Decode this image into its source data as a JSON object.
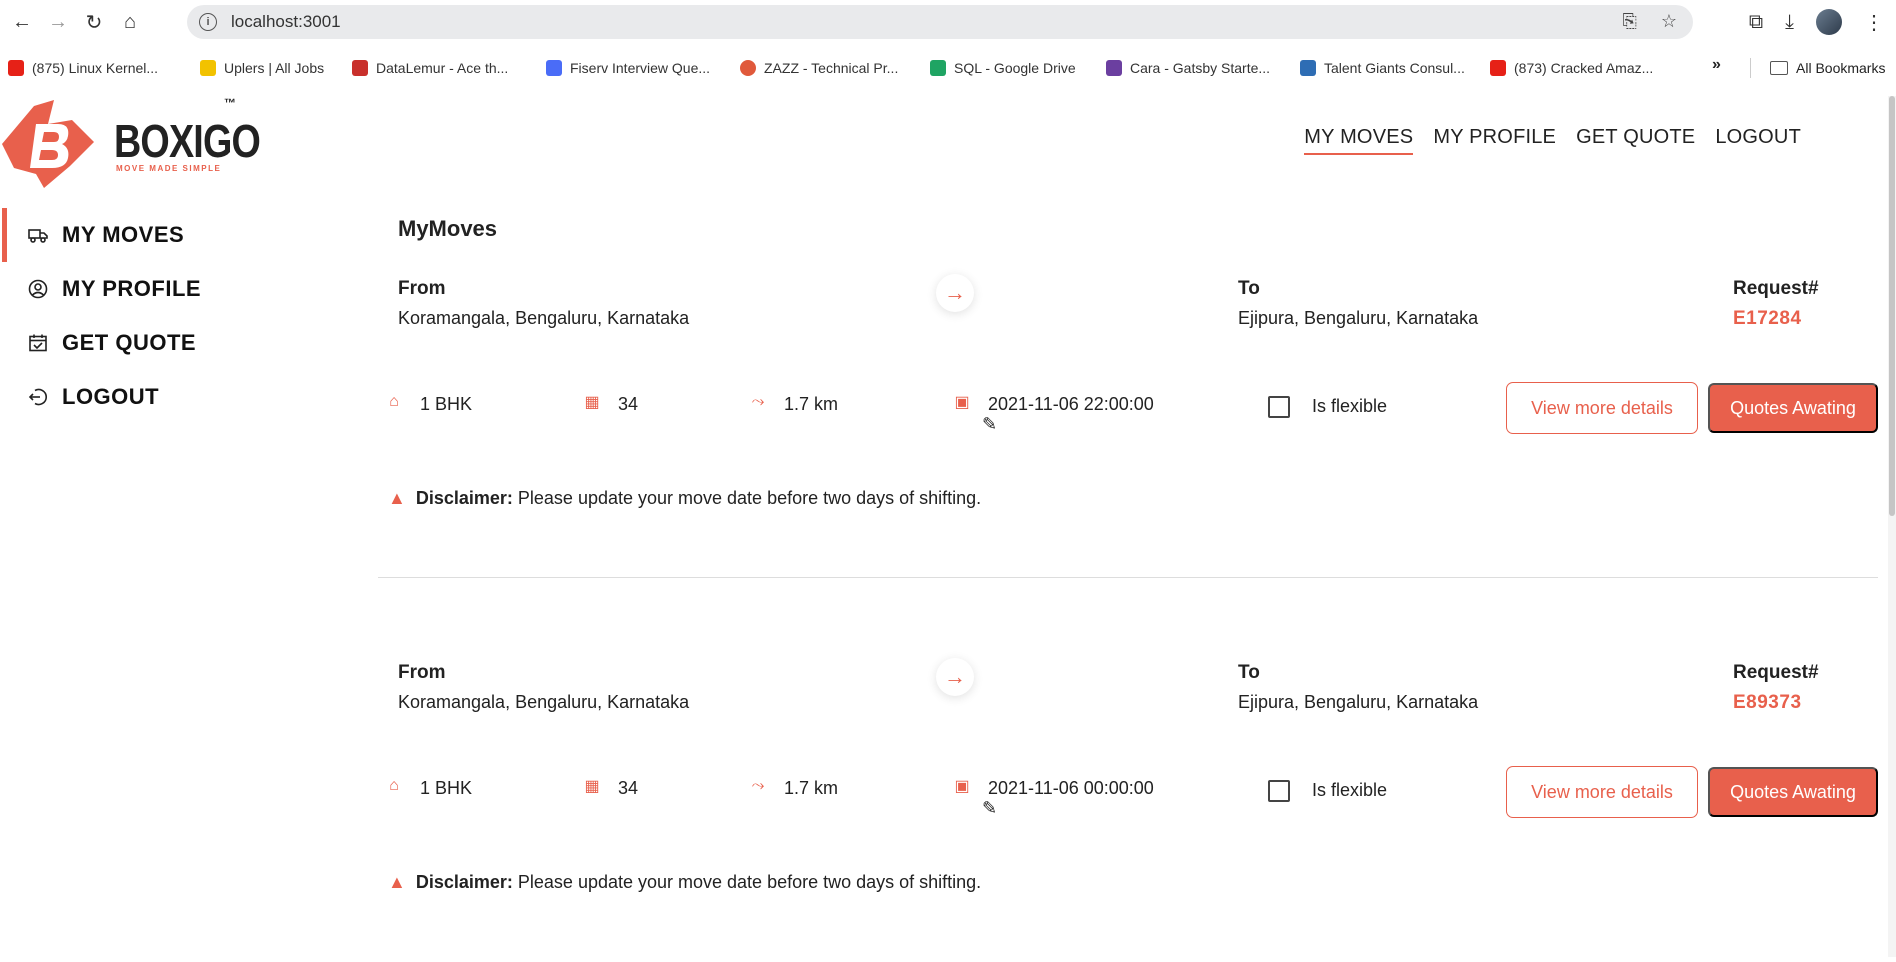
{
  "browser": {
    "url": "localhost:3001",
    "bookmarks": [
      {
        "label": "(875) Linux Kernel...",
        "color": "#e62117"
      },
      {
        "label": "Uplers | All Jobs",
        "color": "#f2c200"
      },
      {
        "label": "DataLemur - Ace th...",
        "color": "#c9302c"
      },
      {
        "label": "Fiserv Interview Que...",
        "color": "#4a6cf7"
      },
      {
        "label": "ZAZZ - Technical Pr...",
        "color": "#e0593b"
      },
      {
        "label": "SQL - Google Drive",
        "color": "#1fa463"
      },
      {
        "label": "Cara - Gatsby Starte...",
        "color": "#6b3fa0"
      },
      {
        "label": "Talent Giants Consul...",
        "color": "#2e6db4"
      },
      {
        "label": "(873) Cracked Amaz...",
        "color": "#e62117"
      }
    ],
    "all_bookmarks": "All Bookmarks"
  },
  "brand": {
    "name": "BOXIGO",
    "tm": "™",
    "tagline": "MOVE MADE SIMPLE",
    "accent": "#e8604c"
  },
  "top_nav": [
    {
      "label": "MY MOVES",
      "active": true
    },
    {
      "label": "MY PROFILE",
      "active": false
    },
    {
      "label": "GET QUOTE",
      "active": false
    },
    {
      "label": "LOGOUT",
      "active": false
    }
  ],
  "sidebar": {
    "items": [
      {
        "label": "MY MOVES",
        "icon": "truck-icon"
      },
      {
        "label": "MY PROFILE",
        "icon": "user-circle-icon"
      },
      {
        "label": "GET QUOTE",
        "icon": "calendar-icon"
      },
      {
        "label": "LOGOUT",
        "icon": "logout-icon"
      }
    ]
  },
  "main": {
    "title": "MyMoves",
    "moves": [
      {
        "from_label": "From",
        "from": "Koramangala, Bengaluru, Karnataka",
        "to_label": "To",
        "to": "Ejipura, Bengaluru, Karnataka",
        "request_label": "Request#",
        "request_id": "E17284",
        "property": "1 BHK",
        "items": "34",
        "distance": "1.7 km",
        "datetime": "2021-11-06 22:00:00",
        "flexible_label": "Is flexible",
        "view_button": "View more details",
        "quotes_button": "Quotes Awating",
        "disclaimer_title": "Disclaimer:",
        "disclaimer_text": "Please update your move date before two days of shifting."
      },
      {
        "from_label": "From",
        "from": "Koramangala, Bengaluru, Karnataka",
        "to_label": "To",
        "to": "Ejipura, Bengaluru, Karnataka",
        "request_label": "Request#",
        "request_id": "E89373",
        "property": "1 BHK",
        "items": "34",
        "distance": "1.7 km",
        "datetime": "2021-11-06 00:00:00",
        "flexible_label": "Is flexible",
        "view_button": "View more details",
        "quotes_button": "Quotes Awating",
        "disclaimer_title": "Disclaimer:",
        "disclaimer_text": "Please update your move date before two days of shifting."
      }
    ]
  }
}
